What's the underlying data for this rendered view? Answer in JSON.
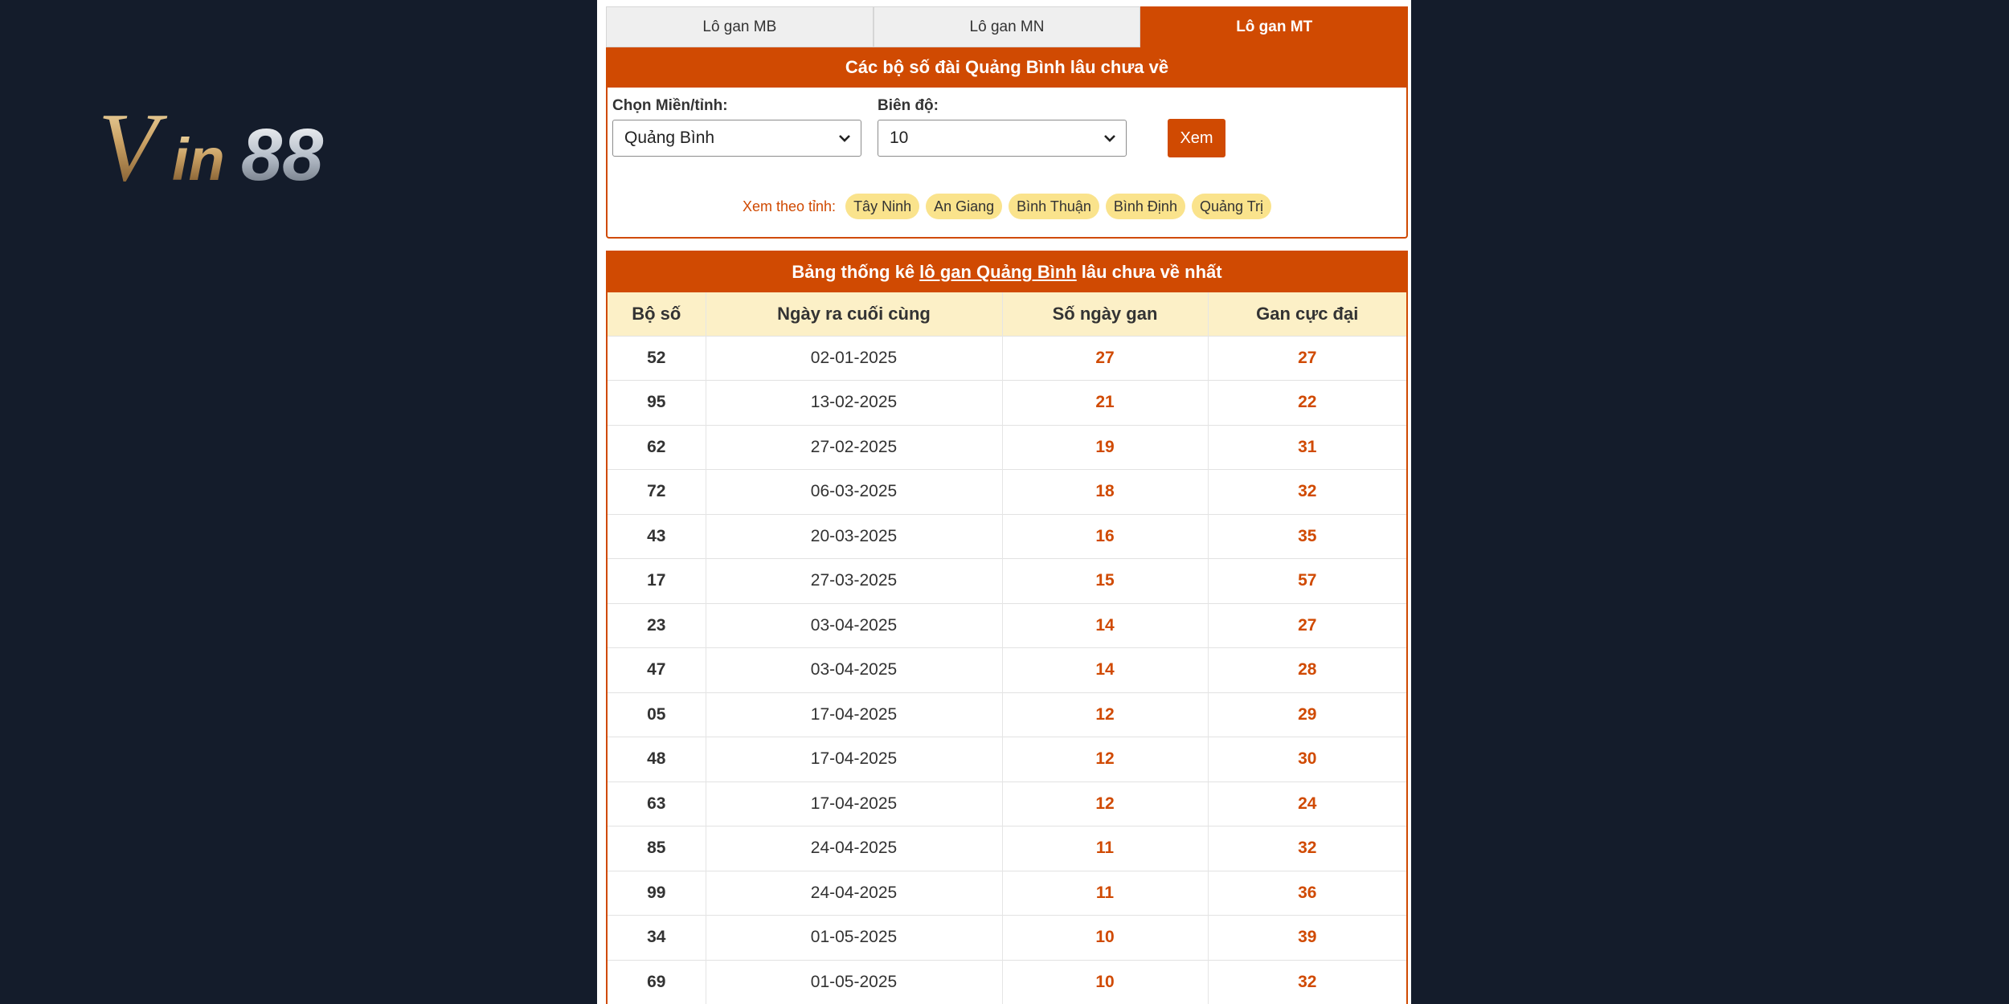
{
  "logo": {
    "text": "Vin88"
  },
  "tabs": [
    {
      "label": "Lô gan MB"
    },
    {
      "label": "Lô gan MN"
    },
    {
      "label": "Lô gan MT"
    }
  ],
  "filter": {
    "title": "Các bộ số đài Quảng Bình lâu chưa về",
    "province_label": "Chọn Miền/tỉnh:",
    "province_value": "Quảng Bình",
    "range_label": "Biên độ:",
    "range_value": "10",
    "submit_label": "Xem",
    "chips_label": "Xem theo tỉnh:",
    "chips": [
      "Tây Ninh",
      "An Giang",
      "Bình Thuận",
      "Bình Định",
      "Quảng Trị"
    ]
  },
  "stats": {
    "title_prefix": "Bảng thống kê",
    "title_link": "lô gan Quảng Bình",
    "title_suffix": "lâu chưa về nhất",
    "headers": [
      "Bộ số",
      "Ngày ra cuối cùng",
      "Số ngày gan",
      "Gan cực đại"
    ],
    "rows": [
      [
        "52",
        "02-01-2025",
        "27",
        "27"
      ],
      [
        "95",
        "13-02-2025",
        "21",
        "22"
      ],
      [
        "62",
        "27-02-2025",
        "19",
        "31"
      ],
      [
        "72",
        "06-03-2025",
        "18",
        "32"
      ],
      [
        "43",
        "20-03-2025",
        "16",
        "35"
      ],
      [
        "17",
        "27-03-2025",
        "15",
        "57"
      ],
      [
        "23",
        "03-04-2025",
        "14",
        "27"
      ],
      [
        "47",
        "03-04-2025",
        "14",
        "28"
      ],
      [
        "05",
        "17-04-2025",
        "12",
        "29"
      ],
      [
        "48",
        "17-04-2025",
        "12",
        "30"
      ],
      [
        "63",
        "17-04-2025",
        "12",
        "24"
      ],
      [
        "85",
        "24-04-2025",
        "11",
        "32"
      ],
      [
        "99",
        "24-04-2025",
        "11",
        "36"
      ],
      [
        "34",
        "01-05-2025",
        "10",
        "39"
      ],
      [
        "69",
        "01-05-2025",
        "10",
        "32"
      ]
    ]
  }
}
